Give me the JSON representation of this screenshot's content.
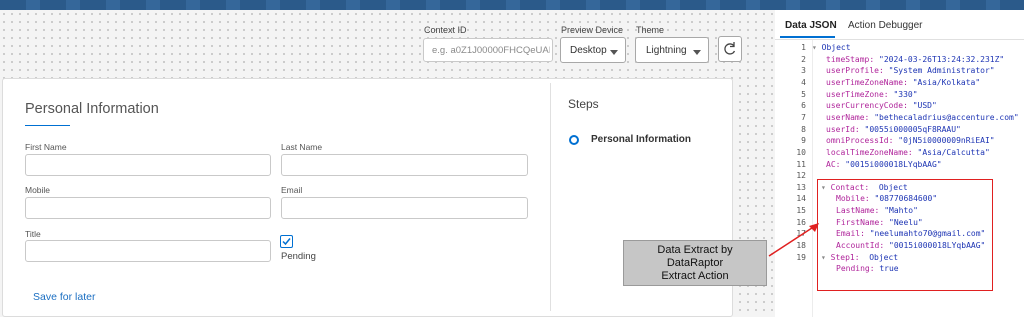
{
  "header": {
    "context_id_label": "Context ID",
    "context_id_placeholder": "e.g. a0Z1J00000FHCQeUAI",
    "preview_device_label": "Preview Device",
    "preview_device_value": "Desktop",
    "theme_label": "Theme",
    "theme_value": "Lightning"
  },
  "form": {
    "title": "Personal Information",
    "first_name_label": "First Name",
    "last_name_label": "Last Name",
    "mobile_label": "Mobile",
    "email_label": "Email",
    "title_label": "Title",
    "pending_label": "Pending",
    "pending_checked": true,
    "save_later_label": "Save for later"
  },
  "steps": {
    "heading": "Steps",
    "items": [
      {
        "label": "Personal Information"
      }
    ]
  },
  "callout": {
    "line1": "Data Extract by",
    "line2": "DataRaptor",
    "line3": "Extract Action",
    "box_color": "#c6c6c6",
    "highlight_color": "#e02020"
  },
  "panel": {
    "tabs": [
      "Data JSON",
      "Action Debugger"
    ],
    "active_tab": "Data JSON",
    "line_numbers": [
      "1",
      "2",
      "3",
      "4",
      "5",
      "6",
      "7",
      "8",
      "9",
      "10",
      "11",
      "12",
      "13",
      "14",
      "15",
      "16",
      "17",
      "18",
      "19"
    ],
    "json_lines": [
      {
        "key": "Object",
        "value": ""
      },
      {
        "key": "timeStamp:",
        "value": "\"2024-03-26T13:24:32.231Z\""
      },
      {
        "key": "userProfile:",
        "value": "\"System Administrator\""
      },
      {
        "key": "userTimeZoneName:",
        "value": "\"Asia/Kolkata\""
      },
      {
        "key": "userTimeZone:",
        "value": "\"330\""
      },
      {
        "key": "userCurrencyCode:",
        "value": "\"USD\""
      },
      {
        "key": "userName:",
        "value": "\"bethecaladrius@accenture.com\""
      },
      {
        "key": "userId:",
        "value": "\"0055i000005qF8RAAU\""
      },
      {
        "key": "omniProcessId:",
        "value": "\"0jN5i0000009nRiEAI\""
      },
      {
        "key": "localTimeZoneName:",
        "value": "\"Asia/Calcutta\""
      },
      {
        "key": "AC:",
        "value": "\"0015i000018LYqbAAG\""
      },
      {
        "key": "Contact:",
        "value": "Object"
      },
      {
        "key": "Mobile:",
        "value": "\"08770684600\""
      },
      {
        "key": "LastName:",
        "value": "\"Mahto\""
      },
      {
        "key": "FirstName:",
        "value": "\"Neelu\""
      },
      {
        "key": "Email:",
        "value": "\"neelumahto70@gmail.com\""
      },
      {
        "key": "AccountId:",
        "value": "\"0015i000018LYqbAAG\""
      },
      {
        "key": "Step1:",
        "value": "Object"
      },
      {
        "key": "Pending:",
        "value": "true"
      }
    ]
  },
  "icons": {
    "refresh": "refresh-icon",
    "checkbox": "checkbox-checked-icon",
    "step_bullet": "radio-circle-icon",
    "expand": "triangle-down-icon"
  },
  "colors": {
    "brand_blue": "#0070d2",
    "key_magenta": "#b0259b",
    "string_blue": "#1e35b4"
  }
}
